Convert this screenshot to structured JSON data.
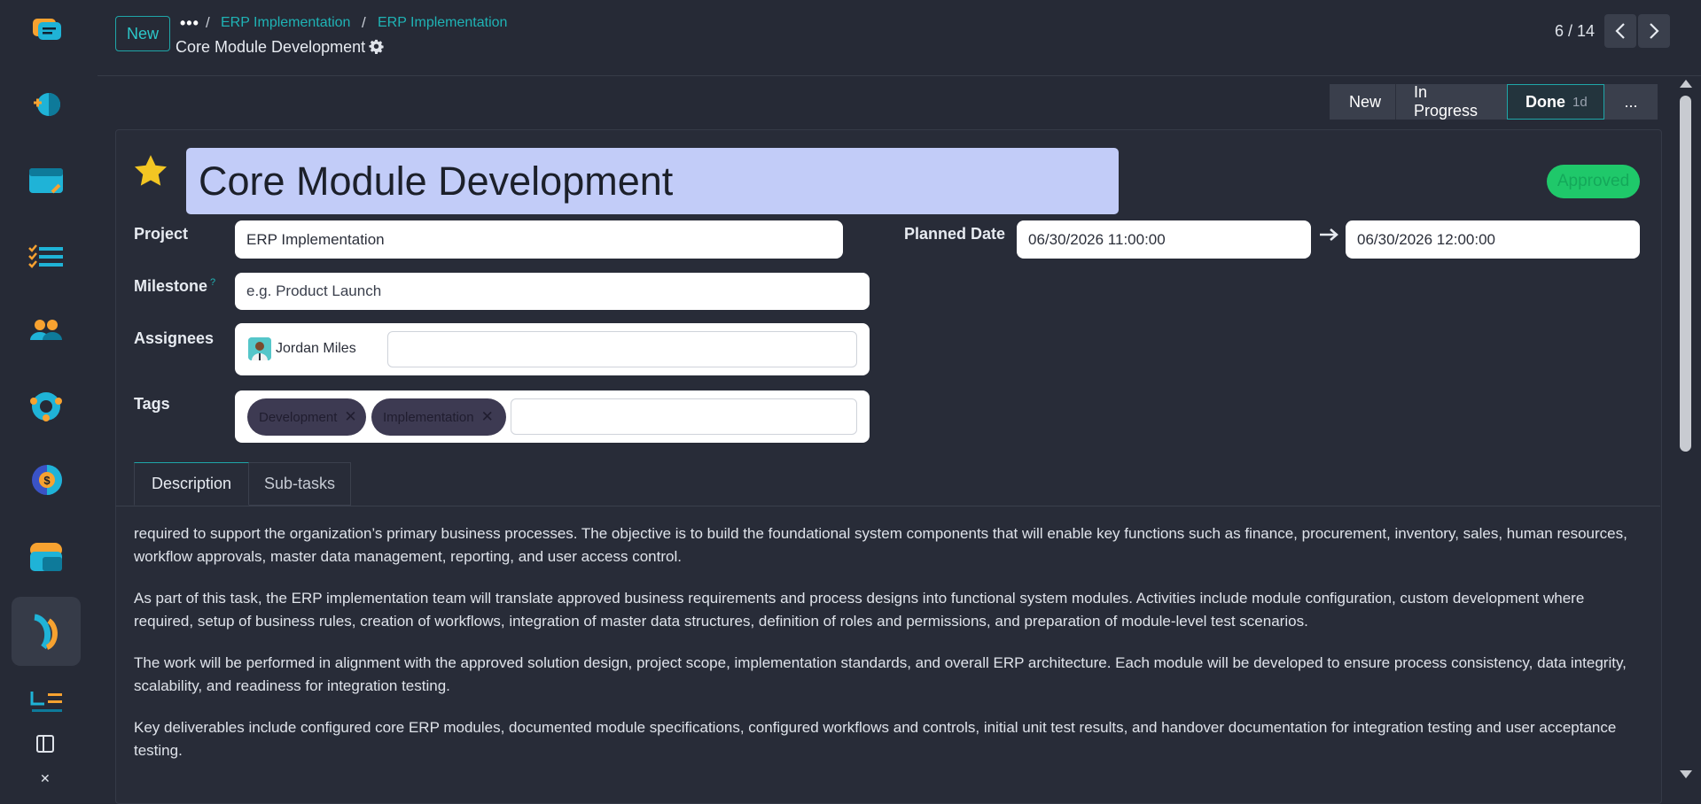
{
  "control_panel": {
    "new_button": "New",
    "breadcrumb_dots": "•••",
    "breadcrumb_sep": "/",
    "breadcrumb": [
      "ERP Implementation",
      "ERP Implementation"
    ],
    "record_title": "Core Module Development",
    "pager": "6 / 14"
  },
  "statusbar": {
    "stages": [
      "New",
      "In Progress",
      "Done"
    ],
    "current_stage": "Done",
    "done_duration": "1d",
    "more": "..."
  },
  "form": {
    "name": "Core Module Development",
    "priority_starred": true,
    "approval_badge": "Approved",
    "project_label": "Project",
    "project_value": "ERP Implementation",
    "planned_date_label": "Planned Date",
    "planned_date_start": "06/30/2026 11:00:00",
    "planned_date_end": "06/30/2026 12:00:00",
    "milestone_label": "Milestone",
    "milestone_help": "?",
    "milestone_placeholder": "e.g. Product Launch",
    "assignees_label": "Assignees",
    "assignees": [
      "Jordan Miles"
    ],
    "tags_label": "Tags",
    "tags": [
      "Development",
      "Implementation"
    ],
    "tag_remove": "✕"
  },
  "notebook": {
    "tabs": [
      "Description",
      "Sub-tasks"
    ],
    "active_tab": "Description",
    "description": [
      "required to support the organization’s primary business processes. The objective is to build the foundational system components that will enable key functions such as finance, procurement, inventory, sales, human resources, workflow approvals, master data management, reporting, and user access control.",
      "As part of this task, the ERP implementation team will translate approved business requirements and process designs into functional system modules. Activities include module configuration, custom development where required, setup of business rules, creation of workflows, integration of master data structures, definition of roles and permissions, and preparation of module-level test scenarios.",
      "The work will be performed in alignment with the approved solution design, project scope, implementation standards, and overall ERP architecture. Each module will be developed to ensure process consistency, data integrity, scalability, and readiness for integration testing.",
      "Key deliverables include configured core ERP modules, documented module specifications, configured workflows and controls, initial unit test results, and handover documentation for integration testing and user acceptance testing."
    ]
  },
  "apps": [
    {
      "icon": "discuss-icon"
    },
    {
      "icon": "appointments-icon"
    },
    {
      "icon": "calendar-icon"
    },
    {
      "icon": "todo-icon"
    },
    {
      "icon": "contacts-icon"
    },
    {
      "icon": "crm-icon"
    },
    {
      "icon": "sales-icon"
    },
    {
      "icon": "dashboards-icon"
    },
    {
      "icon": "project-icon",
      "active": true
    },
    {
      "icon": "timesheets-icon"
    }
  ],
  "colors": {
    "accent": "#1fa6a8",
    "title_bg": "#c2ccf8",
    "approved": "#1fc86a",
    "star": "#f3c623",
    "tag_bg": "#3d3a52"
  }
}
